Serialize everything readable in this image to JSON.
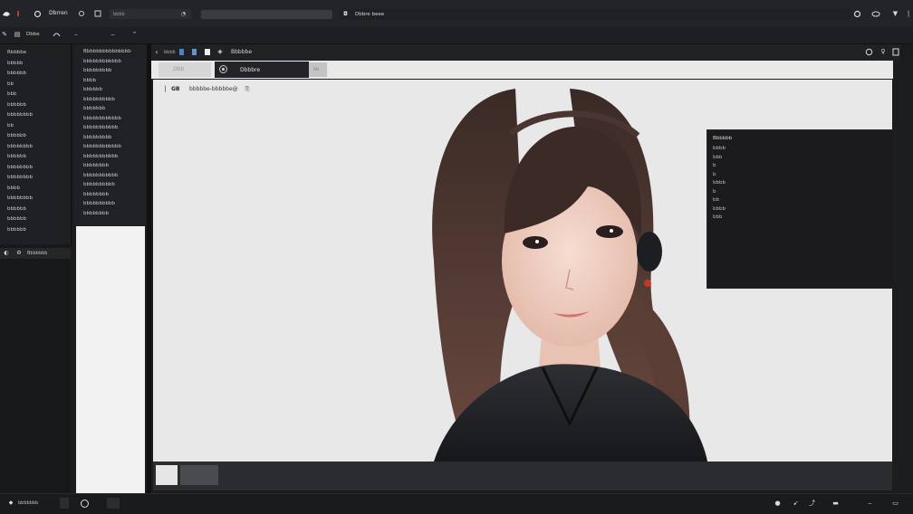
{
  "topbar": {
    "tab_title": "Dbrren",
    "address": "bbbb",
    "center_title": "Dbbre beee"
  },
  "toolbar": {
    "label": "Dbbe"
  },
  "leftnav": {
    "items": [
      "Rbbbbe",
      "bbbbb",
      "bbbbbb",
      "bb",
      "bbb",
      "bbbbbb",
      "bbbbbbbb",
      "bb",
      "bbbbbb",
      "bbbbbbbb",
      "bbbbbb",
      "bbbbbbbb",
      "bbbbbbbb",
      "bbbb",
      "bbbbbbbb",
      "bbbbbb",
      "bbbbbb",
      "bbbbbb"
    ],
    "footer": "Bbbbbbb"
  },
  "filepanel": {
    "items": [
      "Bbbbbbbbbbbbbbb",
      "bbbbbbbbbbbb",
      "bbbbbbbbb",
      "bbbb",
      "bbbbbb",
      "bbbbbbbbbb",
      "bbbbbbb",
      "bbbbbbbbbbbb",
      "bbbbbbbbbbb",
      "bbbbbbbbb",
      "bbbbbbbbbbbb",
      "bbbbbbbbbbb",
      "bbbbbbbb",
      "bbbbbbbbbbb",
      "bbbbbbbbbb",
      "bbbbbbbb",
      "bbbbbbbbbb",
      "bbbbbbbb"
    ]
  },
  "mainbar": {
    "label": "Bbbbbe"
  },
  "tabs": {
    "left": "Dbb",
    "active": "Dbbbre",
    "right": "bb"
  },
  "canvas": {
    "header_text": "bbbbbe-bbbbbe@"
  },
  "overlay": {
    "title": "Bbbbbb",
    "lines": [
      "bbbb",
      "bbb",
      "b",
      "b",
      "bbbb",
      "b",
      "bb",
      "bbbb",
      "bbb"
    ]
  },
  "colors": {
    "accent_red": "#c0392b",
    "panel_dark": "#1b1c1e",
    "canvas_bg": "#e8e8e9"
  }
}
